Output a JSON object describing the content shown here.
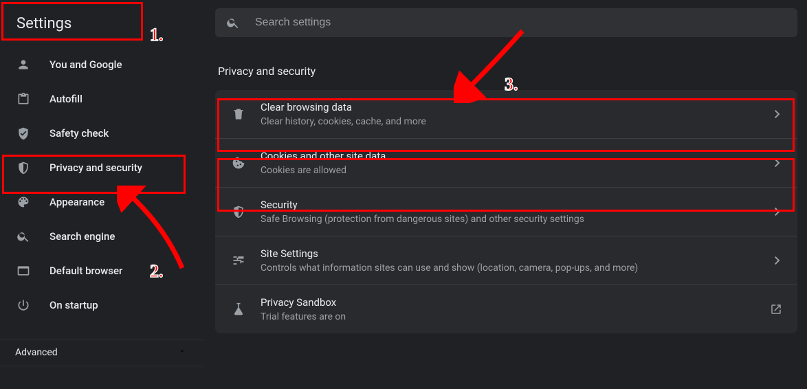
{
  "sidebar": {
    "title": "Settings",
    "items": [
      {
        "label": "You and Google"
      },
      {
        "label": "Autofill"
      },
      {
        "label": "Safety check"
      },
      {
        "label": "Privacy and security"
      },
      {
        "label": "Appearance"
      },
      {
        "label": "Search engine"
      },
      {
        "label": "Default browser"
      },
      {
        "label": "On startup"
      }
    ],
    "advanced_label": "Advanced"
  },
  "search": {
    "placeholder": "Search settings"
  },
  "section": {
    "title": "Privacy and security",
    "rows": [
      {
        "title": "Clear browsing data",
        "desc": "Clear history, cookies, cache, and more"
      },
      {
        "title": "Cookies and other site data",
        "desc": "Cookies are allowed"
      },
      {
        "title": "Security",
        "desc": "Safe Browsing (protection from dangerous sites) and other security settings"
      },
      {
        "title": "Site Settings",
        "desc": "Controls what information sites can use and show (location, camera, pop-ups, and more)"
      },
      {
        "title": "Privacy Sandbox",
        "desc": "Trial features are on"
      }
    ]
  },
  "annotations": {
    "label1": "1.",
    "label2": "2.",
    "label3": "3."
  }
}
